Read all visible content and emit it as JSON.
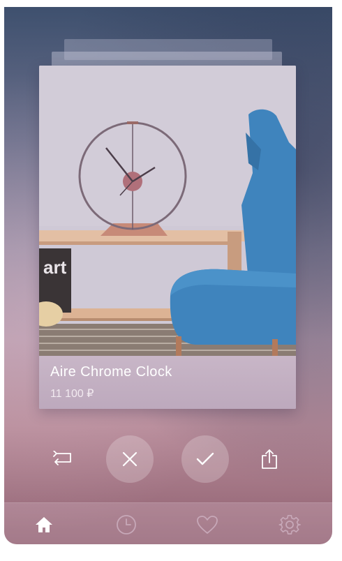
{
  "card": {
    "name": "Aire Chrome Clock",
    "price": "11 100 ₽",
    "poster_text": "art"
  },
  "actions": {
    "undo_icon": "undo-icon",
    "dislike_icon": "close-icon",
    "like_icon": "check-icon",
    "share_icon": "share-icon"
  },
  "tabbar": {
    "items": [
      {
        "icon": "home-icon",
        "active": true
      },
      {
        "icon": "clock-icon",
        "active": false
      },
      {
        "icon": "heart-icon",
        "active": false
      },
      {
        "icon": "gear-icon",
        "active": false
      }
    ]
  },
  "colors": {
    "chair_blue": "#3f84bd",
    "active_tab": "#ffffff",
    "inactive_tab": "#c7a8b8"
  }
}
